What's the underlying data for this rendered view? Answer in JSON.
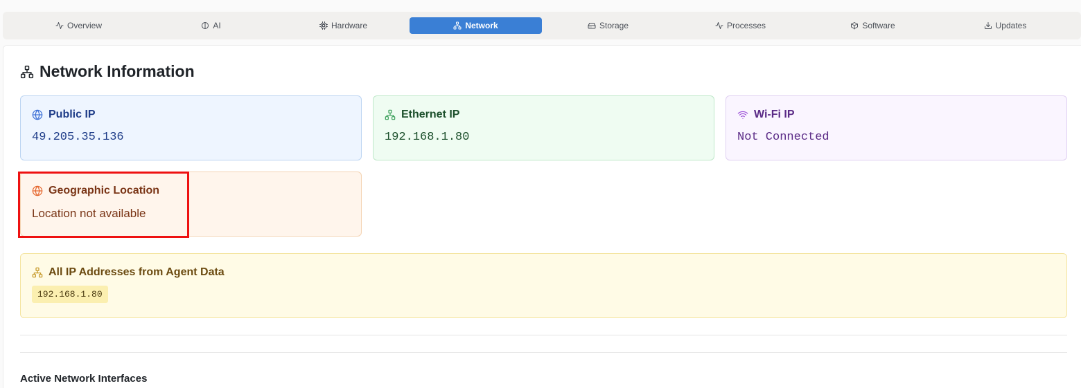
{
  "tabs": [
    {
      "label": "Overview",
      "icon": "activity-icon"
    },
    {
      "label": "AI",
      "icon": "brain-icon"
    },
    {
      "label": "Hardware",
      "icon": "cpu-icon"
    },
    {
      "label": "Network",
      "icon": "network-icon"
    },
    {
      "label": "Storage",
      "icon": "hard-drive-icon"
    },
    {
      "label": "Processes",
      "icon": "activity-icon"
    },
    {
      "label": "Software",
      "icon": "package-icon"
    },
    {
      "label": "Updates",
      "icon": "download-icon"
    }
  ],
  "active_tab": "Network",
  "page": {
    "title": "Network Information"
  },
  "cards": {
    "public_ip": {
      "label": "Public IP",
      "value": "49.205.35.136",
      "icon": "globe-icon"
    },
    "ethernet_ip": {
      "label": "Ethernet IP",
      "value": "192.168.1.80",
      "icon": "network-icon"
    },
    "wifi_ip": {
      "label": "Wi-Fi IP",
      "value": "Not Connected",
      "icon": "wifi-icon"
    },
    "geo": {
      "label": "Geographic Location",
      "value": "Location not available",
      "icon": "globe-icon"
    },
    "all_ips": {
      "label": "All IP Addresses from Agent Data",
      "addresses": [
        "192.168.1.80"
      ],
      "icon": "network-icon"
    }
  },
  "sections": {
    "active_interfaces": "Active Network Interfaces"
  },
  "colors": {
    "accent": "#3a7fd5",
    "highlight": "#ee1111"
  }
}
